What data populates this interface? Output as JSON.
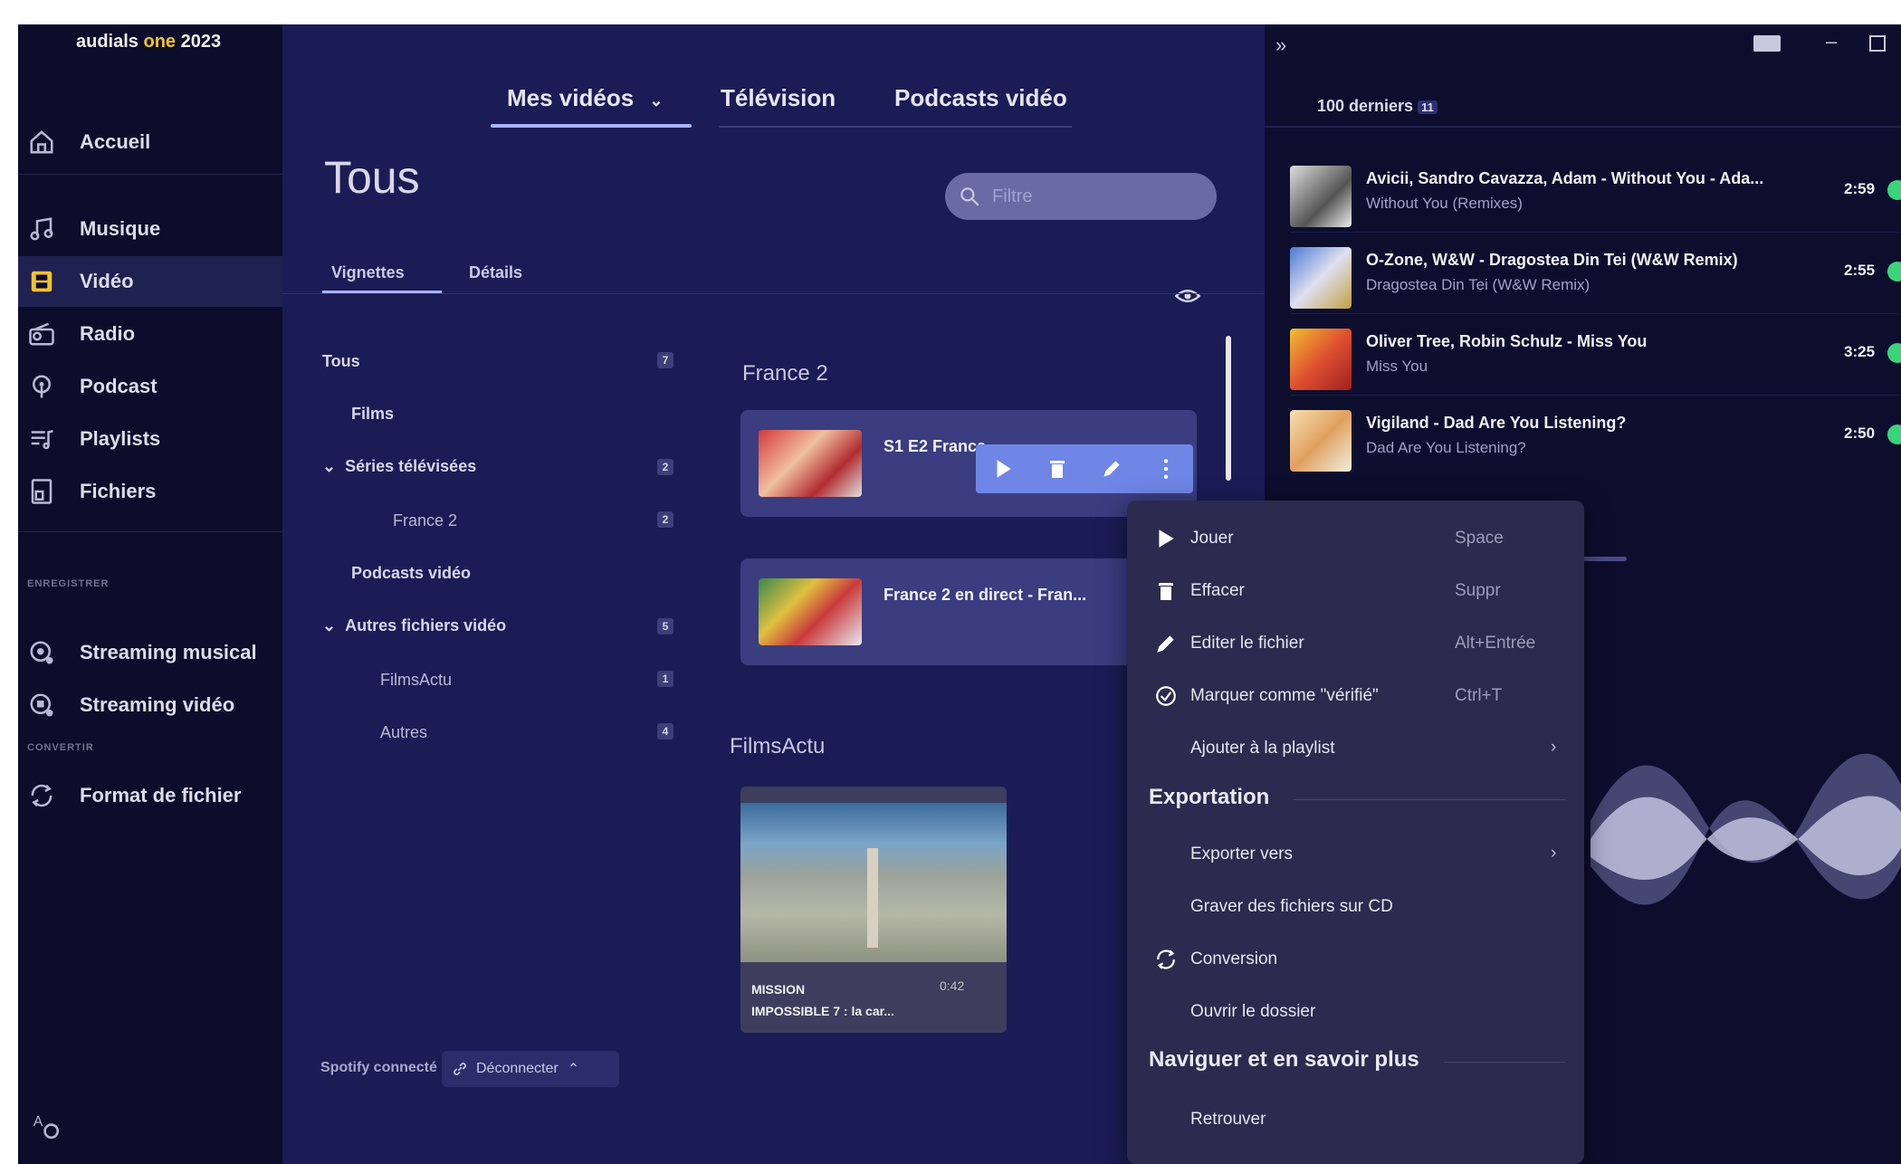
{
  "app": {
    "brand_prefix": "audials ",
    "brand_highlight": "one",
    "brand_suffix": " 2023"
  },
  "sidebar": {
    "items": [
      {
        "label": "Accueil",
        "icon": "home-icon"
      },
      {
        "label": "Musique",
        "icon": "music-icon"
      },
      {
        "label": "Vidéo",
        "icon": "video-icon",
        "active": true
      },
      {
        "label": "Radio",
        "icon": "radio-icon"
      },
      {
        "label": "Podcast",
        "icon": "podcast-icon"
      },
      {
        "label": "Playlists",
        "icon": "playlist-icon"
      },
      {
        "label": "Fichiers",
        "icon": "files-icon"
      }
    ],
    "section_enregistrer": "ENREGISTRER",
    "section_convertir": "CONVERTIR",
    "record_items": [
      {
        "label": "Streaming musical",
        "icon": "music-streaming-icon"
      },
      {
        "label": "Streaming vidéo",
        "icon": "video-streaming-icon"
      }
    ],
    "convert_items": [
      {
        "label": "Format de fichier",
        "icon": "convert-icon"
      }
    ]
  },
  "main": {
    "tabs": [
      {
        "label": "Mes vidéos",
        "active": true
      },
      {
        "label": "Télévision"
      },
      {
        "label": "Podcasts vidéo"
      }
    ],
    "title": "Tous",
    "filter_placeholder": "Filtre",
    "subtabs": [
      "Vignettes",
      "Détails"
    ],
    "tree": [
      {
        "label": "Tous",
        "count": "7"
      },
      {
        "label": "Films"
      },
      {
        "label": "Séries télévisées",
        "count": "2"
      },
      {
        "label": "France 2",
        "count": "2"
      },
      {
        "label": "Podcasts vidéo"
      },
      {
        "label": "Autres fichiers vidéo",
        "count": "5"
      },
      {
        "label": "FilmsActu",
        "count": "1"
      },
      {
        "label": "Autres",
        "count": "4"
      }
    ],
    "groups": [
      {
        "title": "France 2",
        "items": [
          "S1 E2 France",
          "France 2 en direct - Fran..."
        ]
      },
      {
        "title": "FilmsActu",
        "items": [
          {
            "caption_line1": "MISSION",
            "caption_line2": "IMPOSSIBLE 7 : la car...",
            "duration": "0:42"
          }
        ]
      }
    ],
    "spotify_label": "Spotify connecté",
    "disconnect_label": "Déconnecter"
  },
  "right_panel": {
    "header": "100 derniers",
    "header_badge": "11",
    "tracks": [
      {
        "title": "Avicii, Sandro Cavazza, Adam - Without You - Ada...",
        "subtitle": "Without You (Remixes)",
        "duration": "2:59"
      },
      {
        "title": "O-Zone, W&W - Dragostea Din Tei (W&W Remix)",
        "subtitle": "Dragostea Din Tei (W&W Remix)",
        "duration": "2:55"
      },
      {
        "title": "Oliver Tree, Robin Schulz - Miss You",
        "subtitle": "Miss You",
        "duration": "3:25"
      },
      {
        "title": "Vigiland - Dad Are You Listening?",
        "subtitle": "Dad Are You Listening?",
        "duration": "2:50"
      }
    ]
  },
  "context_menu": {
    "items": [
      {
        "label": "Jouer",
        "shortcut": "Space",
        "icon": "play-icon"
      },
      {
        "label": "Effacer",
        "shortcut": "Suppr",
        "icon": "trash-icon"
      },
      {
        "label": "Editer le fichier",
        "shortcut": "Alt+Entrée",
        "icon": "edit-icon"
      },
      {
        "label": "Marquer comme \"vérifié\"",
        "shortcut": "Ctrl+T",
        "icon": "check-circle-icon"
      },
      {
        "label": "Ajouter à la playlist"
      }
    ],
    "export_header": "Exportation",
    "export_items": [
      {
        "label": "Exporter vers"
      },
      {
        "label": "Graver des fichiers sur CD"
      },
      {
        "label": "Conversion",
        "icon": "convert-icon"
      },
      {
        "label": "Ouvrir le dossier"
      }
    ],
    "nav_header": "Naviguer et en savoir plus",
    "nav_items": [
      {
        "label": "Retrouver"
      }
    ]
  },
  "colors": {
    "accent": "#a8b4ff",
    "highlight": "#f2c230",
    "status_green": "#3bd47a"
  }
}
